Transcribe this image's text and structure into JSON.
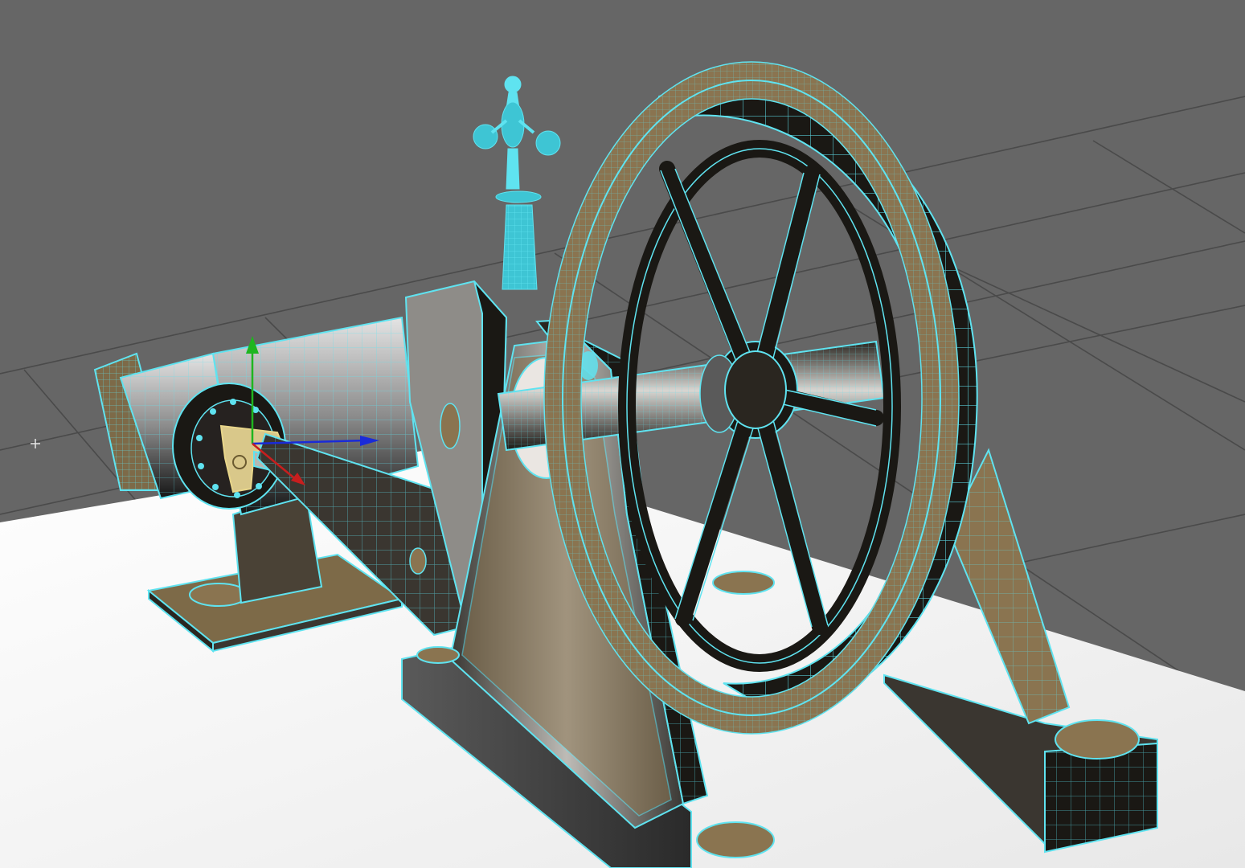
{
  "viewport": {
    "background_color": "#666666",
    "grid_color": "#4a4a4a",
    "ground_color": "#f4f4f4",
    "wireframe_color": "#5fe3f0",
    "metal_dark": "#1a1814",
    "metal_bronze": "#8a7450",
    "metal_light": "#d8d6d2",
    "selection_color": "#e8d68a"
  },
  "manipulator": {
    "axis_colors": {
      "y": "#1fb51f",
      "z": "#1a2bd8",
      "x": "#c81e1e"
    },
    "icon": "move-manipulator-icon"
  },
  "markers": {
    "pivot_icon": "crosshair-icon"
  },
  "model": {
    "icon": "steam-engine-model-icon"
  }
}
